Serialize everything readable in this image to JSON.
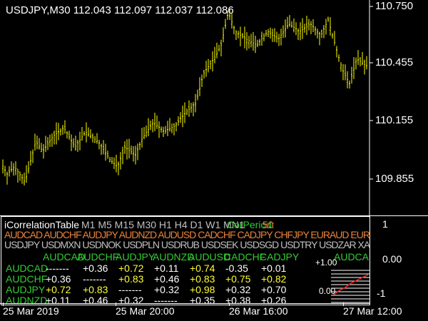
{
  "chart": {
    "title": "USDJPY,M30  112.043 112.097 112.037 112.086",
    "price_labels": [
      "110.750",
      "110.455",
      "110.155",
      "109.855"
    ],
    "time_labels": [
      "25 Mar 2019",
      "25 Mar 20:00",
      "26 Mar 16:00",
      "27 Mar 12:00"
    ],
    "bar_color": "#ffff00"
  },
  "indicator": {
    "name": "iCorrelationTable",
    "timeframes": "M1 M5 M15 M30 H1 H4 D1 W1 MN1",
    "corperiod_label": "CorPeriod:",
    "corperiod_value": "50",
    "pairs_row1": "AUDCAD AUDCHF AUDJPY AUDNZD AUDUSD CADCHF CADJPY CHFJPY EURAUD EURCAD EURCHF",
    "pairs_row2": "USDJPY USDMXN USDNOK USDPLN USDRUB USDSEK USDSGD USDTRY USDZAR XAGUSD",
    "matrix_header": [
      "AUDCAD",
      "AUDCHF",
      "AUDJPY",
      "AUDNZD",
      "AUDUSD",
      "CADCHF",
      "CADJPY"
    ],
    "rows": [
      {
        "name": "AUDCAD",
        "values": [
          "-------",
          "+0.36",
          "+0.72",
          "+0.11",
          "+0.74",
          "-0.35",
          "+0.01"
        ]
      },
      {
        "name": "AUDCHF",
        "values": [
          "+0.36",
          "-------",
          "+0.83",
          "+0.46",
          "+0.83",
          "+0.75",
          "+0.82"
        ]
      },
      {
        "name": "AUDJPY",
        "values": [
          "+0.72",
          "+0.83",
          "-------",
          "+0.32",
          "+0.98",
          "+0.32",
          "+0.70"
        ]
      },
      {
        "name": "AUDNZD",
        "values": [
          "+0.11",
          "+0.46",
          "+0.32",
          "-------",
          "+0.35",
          "+0.38",
          "+0.26"
        ]
      }
    ],
    "mini_label": "AUDCAD",
    "mini_top": "+1.00",
    "mini_mid": "0.00",
    "scale_labels": [
      "1",
      "0.00",
      "-1"
    ],
    "colors": {
      "pairs_orange": "#e8823c",
      "pairs_gray": "#c0c0c0",
      "green": "#33cc33",
      "yellow": "#ffff33",
      "white": "#ffffff"
    }
  }
}
